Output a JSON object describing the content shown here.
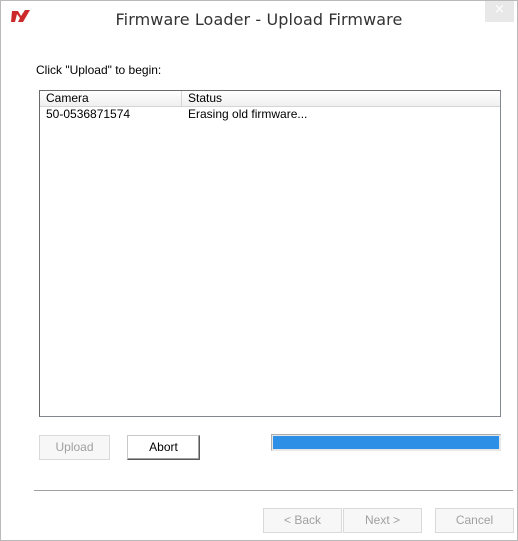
{
  "window": {
    "title": "Firmware Loader - Upload Firmware",
    "close_glyph": "×",
    "app_icon": "camera-logo-icon",
    "app_icon_color": "#cc2a2a"
  },
  "instruction": "Click \"Upload\" to begin:",
  "camera_list": {
    "columns": [
      "Camera",
      "Status"
    ],
    "rows": [
      {
        "camera": "50-0536871574",
        "status": "Erasing old firmware..."
      }
    ]
  },
  "buttons": {
    "upload": "Upload",
    "abort": "Abort",
    "back": "< Back",
    "next": "Next >",
    "cancel": "Cancel"
  },
  "progress": {
    "value": 1.0,
    "color": "#2e8fe6"
  }
}
